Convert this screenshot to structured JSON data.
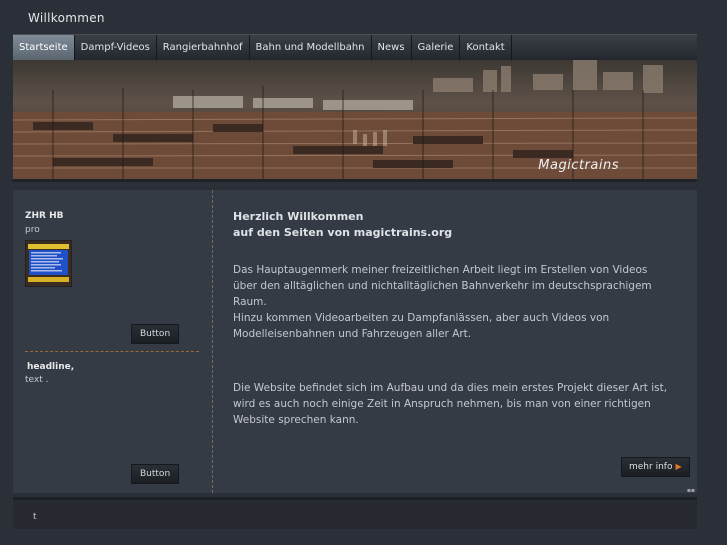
{
  "site": {
    "title": "Willkommen"
  },
  "nav": {
    "items": [
      {
        "label": "Startseite",
        "active": true
      },
      {
        "label": "Dampf-Videos"
      },
      {
        "label": "Rangierbahnhof"
      },
      {
        "label": "Bahn und Modellbahn"
      },
      {
        "label": "News"
      },
      {
        "label": "Galerie"
      },
      {
        "label": "Kontakt"
      }
    ]
  },
  "banner": {
    "logo": "Magictrains"
  },
  "sidebar": {
    "title": "ZHR HB",
    "subtitle": "pro",
    "button1": "Button",
    "headline": "headline,",
    "text": "text .",
    "button2": "Button"
  },
  "main": {
    "heading_line1": "Herzlich Willkommen",
    "heading_line2": "auf den Seiten von magictrains.org",
    "para1": "Das Hauptaugenmerk meiner freizeitlichen Arbeit liegt im Erstellen von Videos über den alltäglichen und nichtalltäglichen Bahnverkehr im deutschsprachigem Raum.",
    "para1b": "Hinzu kommen Videoarbeiten zu Dampfanlässen, aber auch Videos von Modelleisenbahnen und Fahrzeugen aller Art.",
    "para2": "Die Website befindet sich im Aufbau und da dies mein erstes Projekt dieser Art ist, wird es auch noch einige Zeit in Anspruch nehmen, bis man von einer richtigen Website sprechen kann.",
    "more_button": "mehr info"
  },
  "footer": {
    "text": "t"
  },
  "icons": {
    "more_arrow": "arrow-right-icon"
  },
  "colors": {
    "accent": "#e07a2a",
    "background": "#2b3038",
    "content": "#353b44"
  }
}
